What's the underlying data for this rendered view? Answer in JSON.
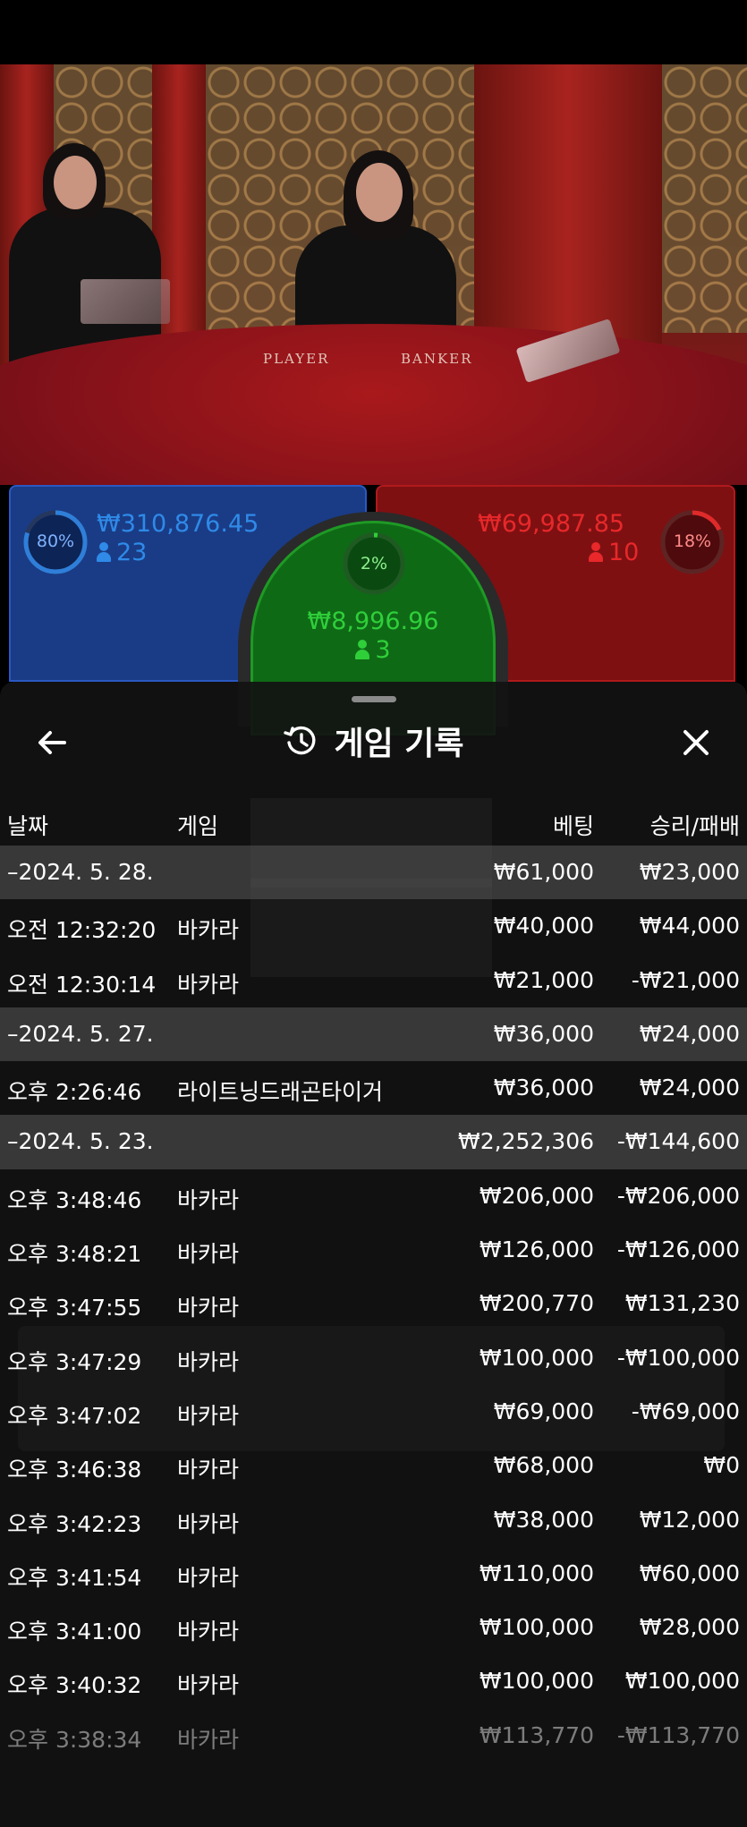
{
  "video": {
    "felt_labels": {
      "player": "PLAYER",
      "banker": "BANKER"
    }
  },
  "bets": {
    "player": {
      "percent": "80%",
      "amount": "₩310,876.45",
      "count": "23",
      "color": "#2f7fd9"
    },
    "tie": {
      "percent": "2%",
      "amount": "₩8,996.96",
      "count": "3",
      "color": "#2fcf3a"
    },
    "banker": {
      "percent": "18%",
      "amount": "₩69,987.85",
      "count": "10",
      "color": "#e02a2a"
    }
  },
  "sheet": {
    "title": "게임 기록",
    "title_icon": "history-icon",
    "back_icon": "arrow-left-icon",
    "close_icon": "close-icon",
    "columns": {
      "date": "날짜",
      "game": "게임",
      "bet": "베팅",
      "winloss": "승리/패배"
    },
    "rows": [
      {
        "type": "date",
        "c1": "–2024. 5. 28.",
        "c2": "",
        "bet": "₩61,000",
        "winloss": "₩23,000"
      },
      {
        "type": "item",
        "c1": "오전 12:32:20",
        "c2": "바카라",
        "bet": "₩40,000",
        "winloss": "₩44,000"
      },
      {
        "type": "item",
        "c1": "오전 12:30:14",
        "c2": "바카라",
        "bet": "₩21,000",
        "winloss": "-₩21,000"
      },
      {
        "type": "date",
        "c1": "–2024. 5. 27.",
        "c2": "",
        "bet": "₩36,000",
        "winloss": "₩24,000"
      },
      {
        "type": "item",
        "c1": "오후 2:26:46",
        "c2": "라이트닝드래곤타이거",
        "bet": "₩36,000",
        "winloss": "₩24,000"
      },
      {
        "type": "date",
        "c1": "–2024. 5. 23.",
        "c2": "",
        "bet": "₩2,252,306",
        "winloss": "-₩144,600"
      },
      {
        "type": "item",
        "c1": "오후 3:48:46",
        "c2": "바카라",
        "bet": "₩206,000",
        "winloss": "-₩206,000"
      },
      {
        "type": "item",
        "c1": "오후 3:48:21",
        "c2": "바카라",
        "bet": "₩126,000",
        "winloss": "-₩126,000"
      },
      {
        "type": "item",
        "c1": "오후 3:47:55",
        "c2": "바카라",
        "bet": "₩200,770",
        "winloss": "₩131,230"
      },
      {
        "type": "item",
        "c1": "오후 3:47:29",
        "c2": "바카라",
        "bet": "₩100,000",
        "winloss": "-₩100,000"
      },
      {
        "type": "item",
        "c1": "오후 3:47:02",
        "c2": "바카라",
        "bet": "₩69,000",
        "winloss": "-₩69,000"
      },
      {
        "type": "item",
        "c1": "오후 3:46:38",
        "c2": "바카라",
        "bet": "₩68,000",
        "winloss": "₩0"
      },
      {
        "type": "item",
        "c1": "오후 3:42:23",
        "c2": "바카라",
        "bet": "₩38,000",
        "winloss": "₩12,000"
      },
      {
        "type": "item",
        "c1": "오후 3:41:54",
        "c2": "바카라",
        "bet": "₩110,000",
        "winloss": "₩60,000"
      },
      {
        "type": "item",
        "c1": "오후 3:41:00",
        "c2": "바카라",
        "bet": "₩100,000",
        "winloss": "₩28,000"
      },
      {
        "type": "item",
        "c1": "오후 3:40:32",
        "c2": "바카라",
        "bet": "₩100,000",
        "winloss": "₩100,000"
      },
      {
        "type": "item",
        "c1": "오후 3:38:34",
        "c2": "바카라",
        "bet": "₩113,770",
        "winloss": "-₩113,770",
        "dim": true
      }
    ]
  }
}
